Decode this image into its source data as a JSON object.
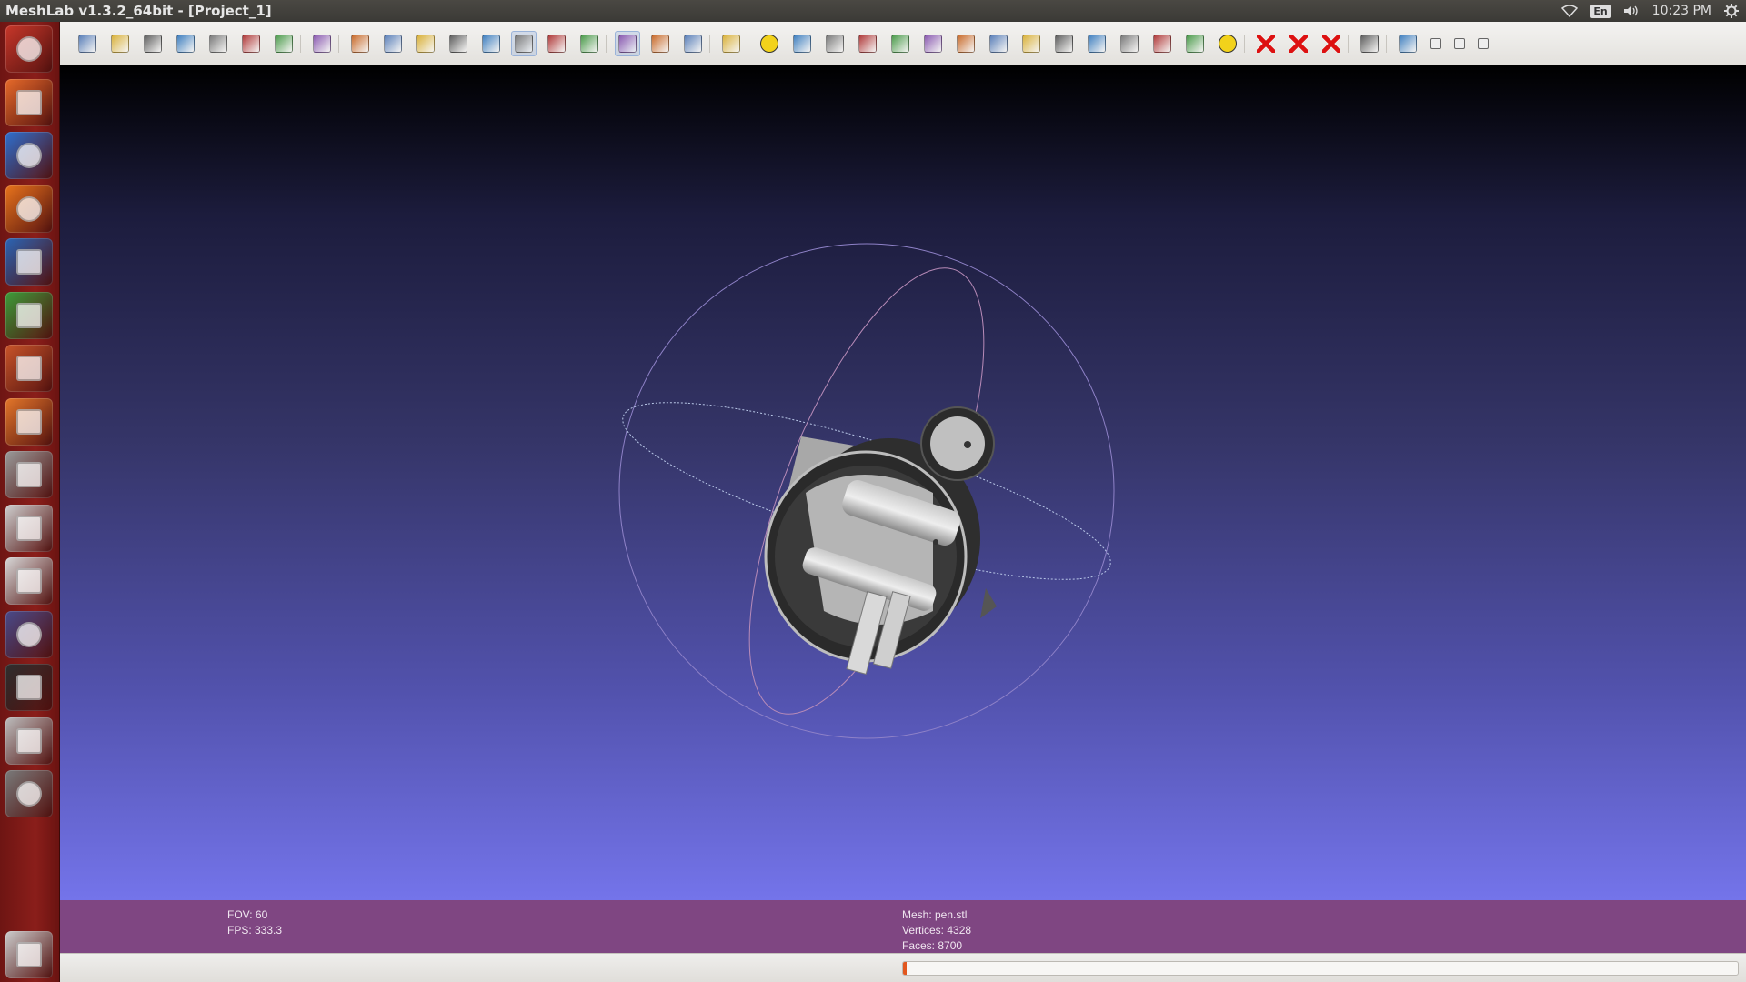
{
  "window": {
    "title": "MeshLab v1.3.2_64bit - [Project_1]"
  },
  "panel": {
    "lang": "En",
    "clock": "10:23 PM"
  },
  "launcher": {
    "items": [
      {
        "name": "ubuntu-dash",
        "color": "#c7372a"
      },
      {
        "name": "files",
        "color": "#e76a2a"
      },
      {
        "name": "chromium",
        "color": "#2f6fcf"
      },
      {
        "name": "firefox",
        "color": "#e8731c"
      },
      {
        "name": "writer",
        "color": "#2b65b5"
      },
      {
        "name": "calc",
        "color": "#3d9c3a"
      },
      {
        "name": "impress",
        "color": "#c9552a"
      },
      {
        "name": "software-center",
        "color": "#e4772a"
      },
      {
        "name": "system-settings",
        "color": "#9a9a9a"
      },
      {
        "name": "drive",
        "color": "#cfcfcf"
      },
      {
        "name": "text-editor",
        "color": "#d8d8d8"
      },
      {
        "name": "eclipse",
        "color": "#4a4a8a"
      },
      {
        "name": "terminal",
        "color": "#2e2e2e"
      },
      {
        "name": "scanner",
        "color": "#bdbdbd"
      },
      {
        "name": "eye-of-gnome",
        "color": "#7a7a7a"
      },
      {
        "name": "trash",
        "color": "#cccccc"
      }
    ]
  },
  "toolbar": {
    "buttons": [
      "new-project",
      "open-project",
      "import-mesh",
      "reload",
      "export-mesh",
      "snapshot",
      "layers",
      "stereo",
      "bbox-view",
      "points-view",
      "wireframe-view",
      "hidden-lines-view",
      "flat-lines-view",
      "flat-view",
      "smooth-view",
      "texture-view",
      "light",
      "double-side-lighting",
      "backface",
      "trackball",
      "annotation-A",
      "color-palette",
      "sphere-filter",
      "measure",
      "paint-brush",
      "pen-brush",
      "pdf-tool",
      "align-1",
      "align-2",
      "color-mesh",
      "select-vertices",
      "select-faces",
      "select-connected",
      "screen-capture",
      "info",
      "delete-vertices",
      "delete-faces",
      "delete-selection",
      "zoom",
      "eye",
      "window-minimize",
      "window-restore",
      "window-close"
    ]
  },
  "info": {
    "fov": "FOV: 60",
    "fps": "FPS:   333.3",
    "mesh": "Mesh: pen.stl",
    "vertices": "Vertices: 4328",
    "faces": "Faces: 8700"
  },
  "progress": {
    "value": 0.004
  },
  "colors": {
    "info_bar": "#7f4682",
    "trackball_ring": "#9b8fd6",
    "progress_fill": "#e2571e"
  }
}
